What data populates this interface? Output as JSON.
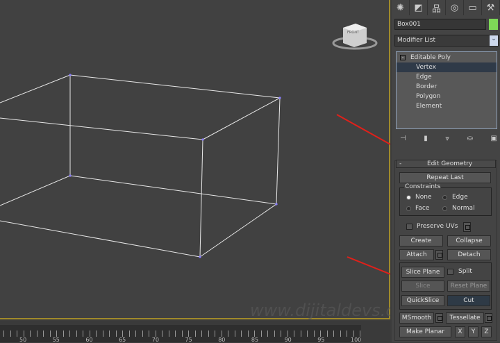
{
  "viewport": {
    "viewcube_label": "FRONT",
    "watermark": "www.dijitaldevs.com"
  },
  "timeline": {
    "labels": [
      "50",
      "55",
      "60",
      "65",
      "70",
      "75",
      "80",
      "85",
      "90",
      "95",
      "100"
    ]
  },
  "panel": {
    "tabs": [
      "create-icon",
      "modify-icon",
      "hierarchy-icon",
      "motion-icon",
      "display-icon",
      "utilities-icon"
    ],
    "object_name": "Box001",
    "object_color": "#7ed957",
    "modifier_list": "Modifier List",
    "stack": {
      "root": "Editable Poly",
      "items": [
        "Vertex",
        "Edge",
        "Border",
        "Polygon",
        "Element"
      ],
      "selected": "Vertex"
    },
    "rollout": {
      "collapse": "-",
      "title": "Edit Geometry",
      "repeat_last": "Repeat Last",
      "constraints": {
        "title": "Constraints",
        "options": [
          "None",
          "Edge",
          "Face",
          "Normal"
        ],
        "selected": "None"
      },
      "preserve_uvs": "Preserve UVs",
      "create": "Create",
      "collapse_btn": "Collapse",
      "attach": "Attach",
      "detach": "Detach",
      "slice_plane": "Slice Plane",
      "split": "Split",
      "slice": "Slice",
      "reset_plane": "Reset Plane",
      "quickslice": "QuickSlice",
      "cut": "Cut",
      "msmooth": "MSmooth",
      "tessellate": "Tessellate",
      "make_planar": "Make Planar",
      "x": "X",
      "y": "Y",
      "z": "Z"
    }
  },
  "annotation_color": "#e0201a"
}
